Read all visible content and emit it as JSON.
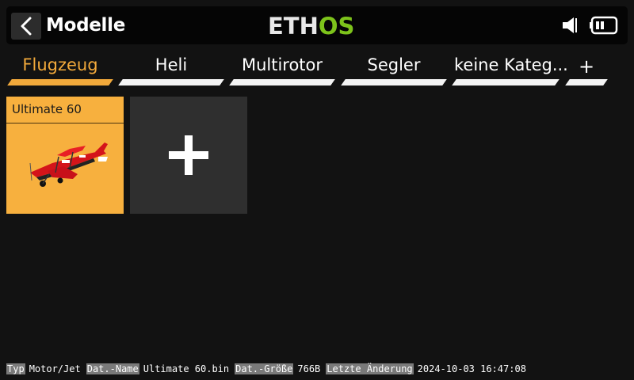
{
  "header": {
    "title": "Modelle",
    "logo": {
      "part1": "ETH",
      "part2": "OS"
    },
    "icons": [
      "chevron-left-icon",
      "speaker-icon",
      "battery-icon"
    ]
  },
  "tabs": [
    {
      "label": "Flugzeug",
      "active": true
    },
    {
      "label": "Heli",
      "active": false
    },
    {
      "label": "Multirotor",
      "active": false
    },
    {
      "label": "Segler",
      "active": false
    },
    {
      "label": "keine Kateg...",
      "active": false
    },
    {
      "label": "+",
      "active": false
    }
  ],
  "models": [
    {
      "name": "Ultimate 60",
      "image_icon": "airplane-icon",
      "selected": true
    }
  ],
  "add_model_icon": "plus-icon",
  "info": {
    "type_label": "Typ",
    "type_value": "Motor/Jet",
    "filename_label": "Dat.-Name",
    "filename_value": "Ultimate 60.bin",
    "size_label": "Dat.-Größe",
    "size_value": "766B",
    "modified_label": "Letzte Änderung",
    "modified_value": "2024-10-03 16:47:08"
  },
  "colors": {
    "accent": "#f2a93b",
    "logo_green": "#7dc31b",
    "background": "#121212"
  }
}
